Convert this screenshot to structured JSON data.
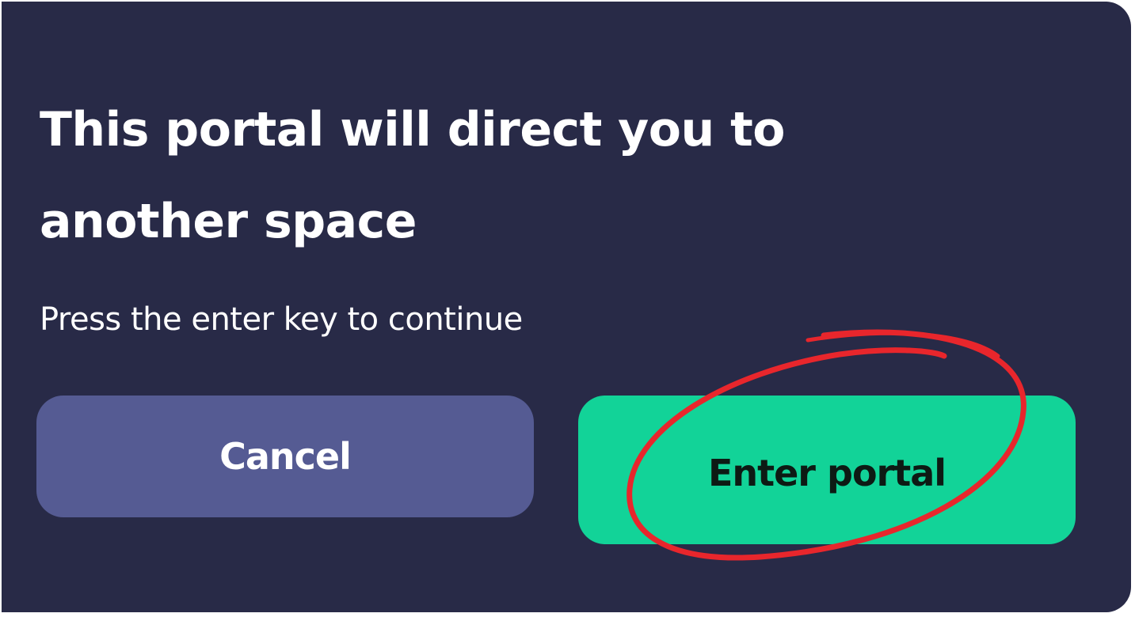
{
  "dialog": {
    "title": "This portal will direct you to another space",
    "subtitle": "Press the enter key to continue",
    "cancel_label": "Cancel",
    "enter_label": "Enter portal"
  },
  "colors": {
    "background": "#282a47",
    "cancel_button": "#555b93",
    "enter_button": "#12d398",
    "annotation": "#e8262c"
  }
}
